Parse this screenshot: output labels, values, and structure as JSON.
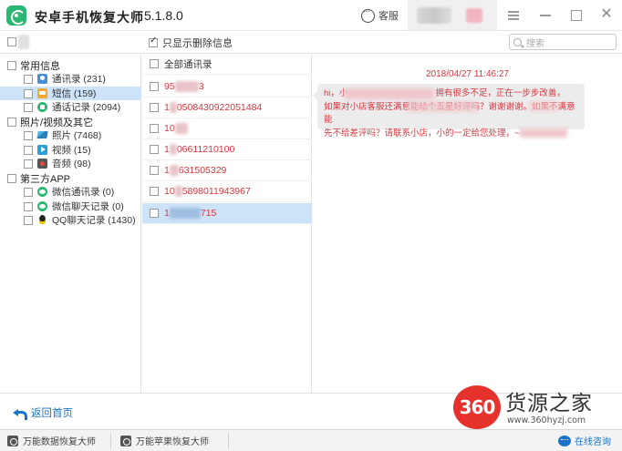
{
  "window": {
    "title": "安卓手机恢复大师",
    "version": "5.1.8.0",
    "kefu_label": "客服"
  },
  "toolbar": {
    "only_deleted_label": "只显示删除信息",
    "only_deleted_checked": true,
    "search_placeholder": "搜索"
  },
  "tree": {
    "groups": [
      {
        "label": "常用信息",
        "items": [
          {
            "label": "通讯录 (231)",
            "icon": "contacts-icon"
          },
          {
            "label": "短信 (159)",
            "icon": "sms-icon",
            "selected": true
          },
          {
            "label": "通话记录 (2094)",
            "icon": "call-log-icon"
          }
        ]
      },
      {
        "label": "照片/视频及其它",
        "items": [
          {
            "label": "照片 (7468)",
            "icon": "photo-icon"
          },
          {
            "label": "视频 (15)",
            "icon": "video-icon"
          },
          {
            "label": "音频 (98)",
            "icon": "audio-icon"
          }
        ]
      },
      {
        "label": "第三方APP",
        "items": [
          {
            "label": "微信通讯录 (0)",
            "icon": "wechat-icon"
          },
          {
            "label": "微信聊天记录 (0)",
            "icon": "wechat-icon"
          },
          {
            "label": "QQ聊天记录 (1430)",
            "icon": "qq-icon"
          }
        ]
      }
    ]
  },
  "contacts_list": {
    "header": "全部通讯录",
    "rows": [
      {
        "prefix": "95",
        "suffix": "3"
      },
      {
        "prefix": "1",
        "suffix": "0508430922051484"
      },
      {
        "prefix": "10",
        "suffix": ""
      },
      {
        "prefix": "1",
        "suffix": "06611210100"
      },
      {
        "prefix": "1",
        "suffix": "631505329"
      },
      {
        "prefix": "10",
        "suffix": "5898011943967"
      },
      {
        "prefix": "1",
        "suffix": "715",
        "selected": true
      }
    ]
  },
  "message": {
    "time": "2018/04/27 11:46:27",
    "line1_start": "hi，小",
    "line1_end": "拥有很多不足，正在一步步改善，",
    "line2": "如果对小店客服还满意能给个五星好评吗？谢谢谢谢。如果不满意能",
    "line3": "先不给差评吗？请联系小店，小的一定给您处理，~"
  },
  "footer": {
    "back_label": "返回首页",
    "tool1_label": "万能数据恢复大师",
    "tool2_label": "万能苹果恢复大师",
    "online_label": "在线咨询"
  },
  "watermark": {
    "logo_text": "360",
    "name": "货源之家",
    "url": "www.360hyzj.com"
  },
  "colors": {
    "accent": "#1a73c8",
    "highlight": "#d9363e",
    "selection": "#cde3f7",
    "brand_green": "#2bb673"
  }
}
